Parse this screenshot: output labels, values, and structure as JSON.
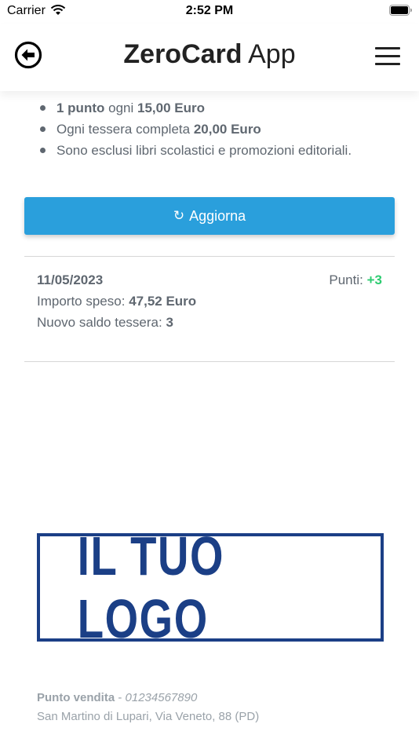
{
  "status_bar": {
    "carrier": "Carrier",
    "time": "2:52 PM"
  },
  "header": {
    "title_bold": "ZeroCard",
    "title_light": "App"
  },
  "rules": {
    "item1": {
      "bold": "1 punto",
      "mid": "ogni",
      "value": "15,00 Euro"
    },
    "item2": {
      "text": "Ogni tessera completa",
      "value": "20,00 Euro"
    },
    "item3": {
      "text": "Sono esclusi libri scolastici e promozioni editoriali."
    }
  },
  "refresh": {
    "label": "Aggiorna"
  },
  "transaction": {
    "date": "11/05/2023",
    "points_label": "Punti:",
    "points_value": "+3",
    "amount_label": "Importo speso:",
    "amount_value": "47,52 Euro",
    "balance_label": "Nuovo saldo tessera:",
    "balance_value": "3"
  },
  "logo": {
    "text": "IL TUO LOGO"
  },
  "footer": {
    "store_label": "Punto vendita",
    "phone": "01234567890",
    "address": "San Martino di Lupari, Via Veneto, 88 (PD)"
  },
  "colors": {
    "primary": "#2a9fdc",
    "positive": "#2ecc71",
    "logo": "#1b3f86",
    "text": "#5f6770"
  }
}
